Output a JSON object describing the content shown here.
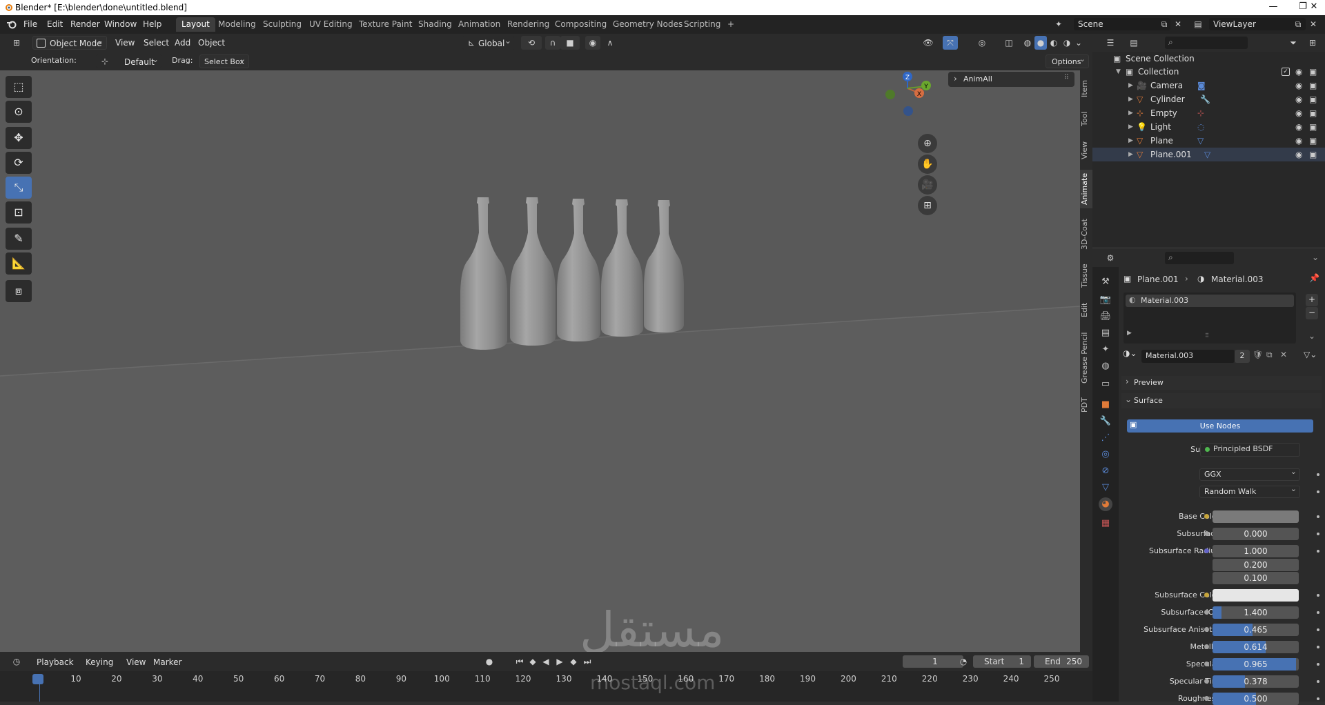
{
  "window": {
    "title": "Blender* [E:\\blender\\done\\untitled.blend]",
    "minimize": "—",
    "maximize": "❐",
    "close": "✕"
  },
  "menu": [
    "File",
    "Edit",
    "Render",
    "Window",
    "Help"
  ],
  "workspaces": [
    "Layout",
    "Modeling",
    "Sculpting",
    "UV Editing",
    "Texture Paint",
    "Shading",
    "Animation",
    "Rendering",
    "Compositing",
    "Geometry Nodes",
    "Scripting"
  ],
  "active_workspace": "Layout",
  "add_workspace": "+",
  "scene": {
    "name": "Scene",
    "view_layer": "ViewLayer"
  },
  "viewport_header": {
    "mode": "Object Mode",
    "menus": [
      "View",
      "Select",
      "Add",
      "Object"
    ],
    "transform_orientation": "Global"
  },
  "tool_settings": {
    "orientation_label": "Orientation:",
    "orientation_value": "Default",
    "drag_label": "Drag:",
    "drag_value": "Select Box",
    "options": "Options"
  },
  "npanel": {
    "section": "AnimAll",
    "tabs": [
      "Item",
      "Tool",
      "View",
      "Animate",
      "3D-Coat",
      "Tissue",
      "Edit",
      "Grease Pencil",
      "PDT"
    ]
  },
  "gizmo": {
    "x": "X",
    "y": "Y",
    "z": "Z"
  },
  "outliner": {
    "root": "Scene Collection",
    "collection": "Collection",
    "objects": [
      "Camera",
      "Cylinder",
      "Empty",
      "Light",
      "Plane",
      "Plane.001"
    ]
  },
  "properties": {
    "breadcrumb_object": "Plane.001",
    "breadcrumb_material": "Material.003",
    "slot": "Material.003",
    "material_name": "Material.003",
    "user_count": "2",
    "preview": "Preview",
    "surface_panel": "Surface",
    "use_nodes": "Use Nodes",
    "surface_label": "Surface",
    "surface_value": "Principled BSDF",
    "distribution": "GGX",
    "subsurface_method": "Random Walk",
    "fields": [
      {
        "label": "Base Color",
        "value": "",
        "kind": "color",
        "color": "#7a7a7a",
        "socket": "#c7a53b"
      },
      {
        "label": "Subsurface",
        "value": "0.000",
        "kind": "num",
        "fill": 0,
        "socket": "#a1a1a1"
      },
      {
        "label": "Subsurface Radius",
        "value": "1.000",
        "kind": "num",
        "fill": 0,
        "socket": "#6363c7"
      },
      {
        "label": "",
        "value": "0.200",
        "kind": "num",
        "fill": 0,
        "socket": ""
      },
      {
        "label": "",
        "value": "0.100",
        "kind": "num",
        "fill": 0,
        "socket": ""
      },
      {
        "label": "Subsurface Color",
        "value": "",
        "kind": "color",
        "color": "#e6e6e6",
        "socket": "#c7a53b"
      },
      {
        "label": "Subsurface IOR",
        "value": "1.400",
        "kind": "num",
        "fill": 0.1,
        "socket": "#a1a1a1"
      },
      {
        "label": "Subsurface Anisot...",
        "value": "0.465",
        "kind": "num",
        "fill": 0.465,
        "socket": "#a1a1a1"
      },
      {
        "label": "Metallic",
        "value": "0.614",
        "kind": "num",
        "fill": 0.614,
        "socket": "#a1a1a1"
      },
      {
        "label": "Specular",
        "value": "0.965",
        "kind": "num",
        "fill": 0.965,
        "socket": "#a1a1a1"
      },
      {
        "label": "Specular Tint",
        "value": "0.378",
        "kind": "num",
        "fill": 0.378,
        "socket": "#a1a1a1"
      },
      {
        "label": "Roughness",
        "value": "0.500",
        "kind": "num",
        "fill": 0.5,
        "socket": "#a1a1a1"
      }
    ]
  },
  "timeline": {
    "menus": [
      "Playback",
      "Keying",
      "View",
      "Marker"
    ],
    "current_frame": "1",
    "start_label": "Start",
    "start": "1",
    "end_label": "End",
    "end": "250",
    "ticks": [
      "1",
      "10",
      "20",
      "30",
      "40",
      "50",
      "60",
      "70",
      "80",
      "90",
      "100",
      "110",
      "120",
      "130",
      "140",
      "150",
      "160",
      "170",
      "180",
      "190",
      "200",
      "210",
      "220",
      "230",
      "240",
      "250"
    ]
  },
  "watermark": {
    "arabic": "مستقل",
    "latin": "mostaql.com"
  },
  "colors": {
    "accent": "#4772b3",
    "viewport_bg": "#595959"
  }
}
